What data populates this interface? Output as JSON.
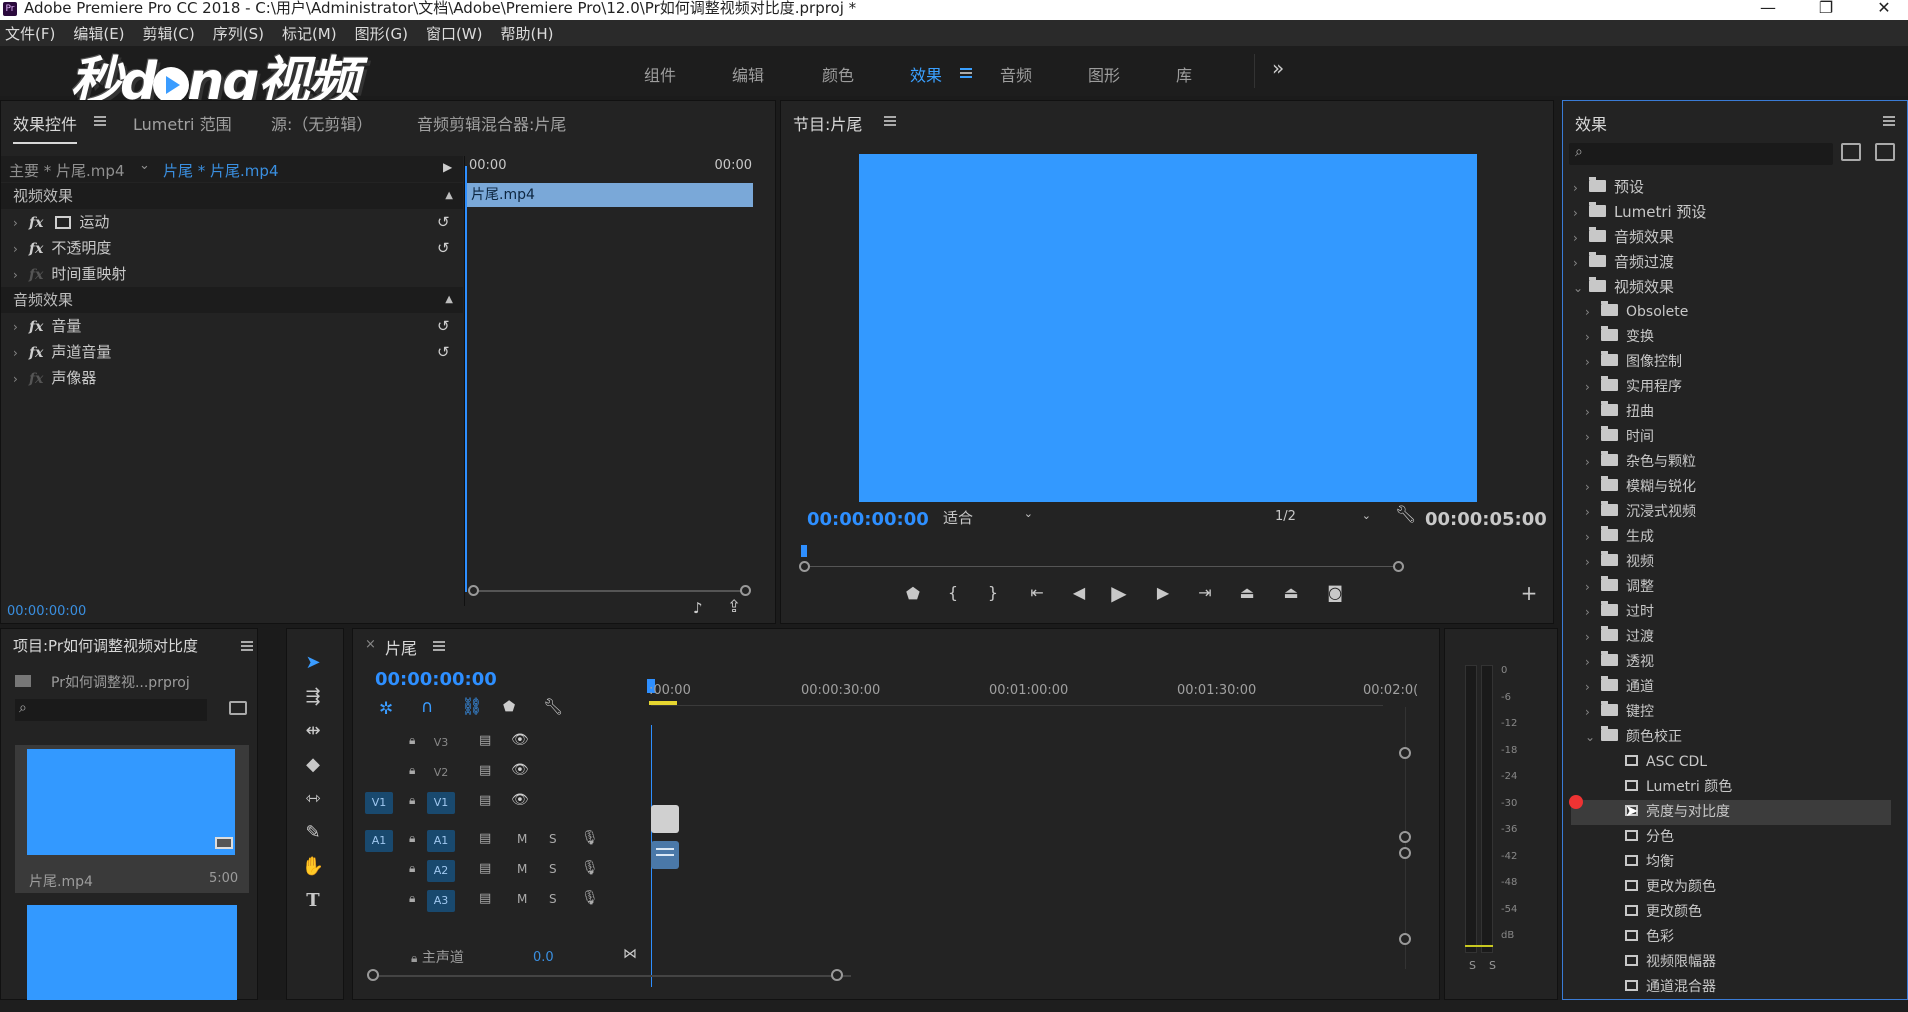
{
  "window": {
    "title": "Adobe Premiere Pro CC 2018 - C:\\用户\\Administrator\\文档\\Adobe\\Premiere Pro\\12.0\\Pr如何调整视频对比度.prproj *",
    "minimize": "—",
    "restore": "❐",
    "close": "✕"
  },
  "menu": [
    "文件(F)",
    "编辑(E)",
    "剪辑(C)",
    "序列(S)",
    "标记(M)",
    "图形(G)",
    "窗口(W)",
    "帮助(H)"
  ],
  "watermark": {
    "part1": "秒d",
    "part2": "ng视频"
  },
  "workspace": {
    "tabs": [
      "组件",
      "编辑",
      "颜色",
      "效果",
      "音频",
      "图形",
      "库"
    ],
    "active": "效果",
    "more": "»"
  },
  "effect_controls": {
    "tabs": [
      "效果控件",
      "Lumetri 范围",
      "源:（无剪辑）",
      "音频剪辑混合器:片尾"
    ],
    "master": "主要 * 片尾.mp4",
    "clip": "片尾 * 片尾.mp4",
    "video_section": "视频效果",
    "audio_section": "音频效果",
    "video_effects": [
      "运动",
      "不透明度",
      "时间重映射"
    ],
    "audio_effects": [
      "音量",
      "声道音量",
      "声像器"
    ],
    "fx_label": "fx",
    "ruler_start": "00:00",
    "ruler_end": "00:00",
    "clip_name": "片尾.mp4",
    "timecode": "00:00:00:00"
  },
  "program": {
    "title": "节目:片尾",
    "timecode": "00:00:00:00",
    "fit": "适合",
    "resolution": "1/2",
    "duration": "00:00:05:00",
    "preview_color": "#3399ff"
  },
  "effects_panel": {
    "title": "效果",
    "top_items": [
      "预设",
      "Lumetri 预设",
      "音频效果",
      "音频过渡",
      "视频效果"
    ],
    "video_subfolders": [
      "Obsolete",
      "变换",
      "图像控制",
      "实用程序",
      "扭曲",
      "时间",
      "杂色与颗粒",
      "模糊与锐化",
      "沉浸式视频",
      "生成",
      "视频",
      "调整",
      "过时",
      "过渡",
      "透视",
      "通道",
      "键控",
      "颜色校正"
    ],
    "color_correction": [
      "ASC CDL",
      "Lumetri 颜色",
      "亮度与对比度",
      "分色",
      "均衡",
      "更改为颜色",
      "更改颜色",
      "色彩",
      "视频限幅器",
      "通道混合器"
    ],
    "selected": "亮度与对比度"
  },
  "project": {
    "title": "项目:Pr如何调整视频对比度",
    "file": "Pr如何调整视...prproj",
    "clip_name": "片尾.mp4",
    "clip_duration": "5:00"
  },
  "timeline": {
    "title": "片尾",
    "close": "×",
    "timecode": "00:00:00:00",
    "ruler": [
      ":00:00",
      "00:00:30:00",
      "00:01:00:00",
      "00:01:30:00",
      "00:02:0("
    ],
    "video_tracks": [
      "V3",
      "V2",
      "V1"
    ],
    "audio_tracks": [
      "A1",
      "A2",
      "A3"
    ],
    "source_v": "V1",
    "source_a": "A1",
    "mute": "M",
    "solo": "S",
    "master": "主声道",
    "master_vol": "0.0"
  },
  "meter": {
    "labels": [
      "0",
      "-6",
      "-12",
      "-18",
      "-24",
      "-30",
      "-36",
      "-42",
      "-48",
      "-54",
      "dB"
    ],
    "solo": [
      "S",
      "S"
    ]
  }
}
